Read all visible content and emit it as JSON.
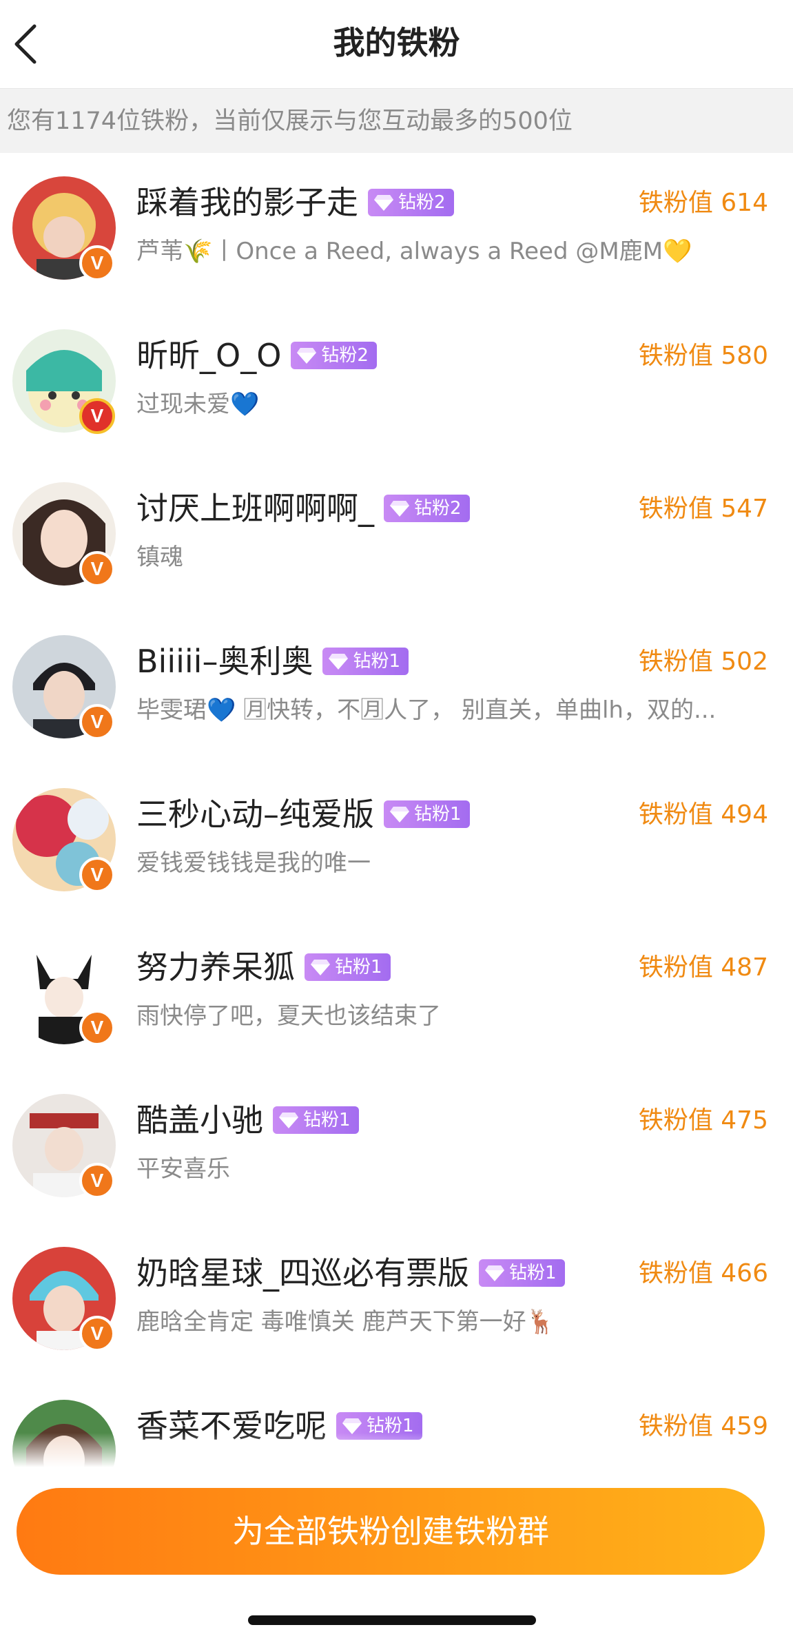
{
  "header": {
    "title": "我的铁粉",
    "back_icon": "chevron-left-icon"
  },
  "notice": "您有1174位铁粉，当前仅展示与您互动最多的500位",
  "colors": {
    "accent": "#f08a12",
    "rank_badge": "#b47cf2",
    "cta_start": "#ff7a12",
    "cta_end": "#ffb31a"
  },
  "fans": [
    {
      "name": "踩着我的影子走",
      "rank": "钻粉2",
      "score": "铁粉值 614",
      "bio": "芦苇🌾丨Once a Reed, always a Reed @M鹿M💛"
    },
    {
      "name": "昕昕_O_O",
      "rank": "钻粉2",
      "score": "铁粉值 580",
      "bio": "过现未爱💙"
    },
    {
      "name": "讨厌上班啊啊啊_",
      "rank": "钻粉2",
      "score": "铁粉值 547",
      "bio": "镇魂"
    },
    {
      "name": "Biiiii–奥利奥",
      "rank": "钻粉1",
      "score": "铁粉值 502",
      "bio": "毕雯珺💙 🈷快转，不🈷人了， 别直关，单曲lh，双的..."
    },
    {
      "name": "三秒心动–纯爱版",
      "rank": "钻粉1",
      "score": "铁粉值 494",
      "bio": "爱钱爱钱钱是我的唯一"
    },
    {
      "name": "努力养呆狐",
      "rank": "钻粉1",
      "score": "铁粉值 487",
      "bio": "雨快停了吧，夏天也该结束了"
    },
    {
      "name": "酷盖小驰",
      "rank": "钻粉1",
      "score": "铁粉值 475",
      "bio": "平安喜乐"
    },
    {
      "name": "奶晗星球_四巡必有票版",
      "rank": "钻粉1",
      "score": "铁粉值 466",
      "bio": "鹿晗全肯定 毒唯慎关 鹿芦天下第一好🦌"
    },
    {
      "name": "香菜不爱吃呢",
      "rank": "钻粉1",
      "score": "铁粉值 459",
      "bio": ""
    }
  ],
  "cta_label": "为全部铁粉创建铁粉群"
}
